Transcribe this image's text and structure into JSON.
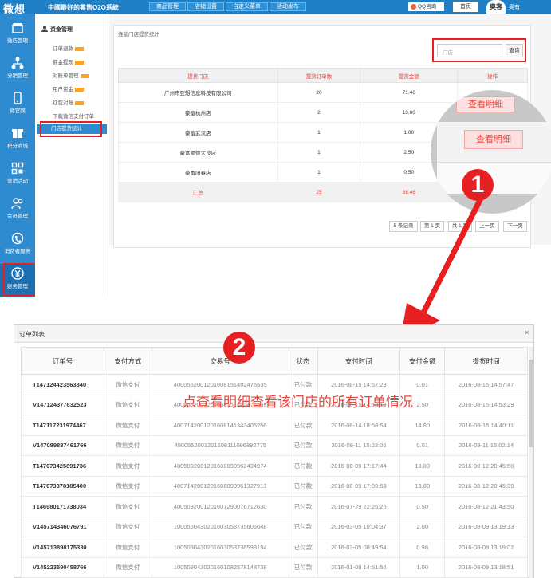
{
  "header": {
    "logo": "微想",
    "slogan": "中國最好的零售O2O系統",
    "nav": [
      "商品管理",
      "店铺设置",
      "自定义菜单",
      "活动发布"
    ],
    "qq": "QQ咨询",
    "home": "首页",
    "avatar_text": "奥客",
    "user": "奥有"
  },
  "sidebar": {
    "items": [
      {
        "label": "微店管理",
        "icon": "store-icon"
      },
      {
        "label": "分销管理",
        "icon": "distribution-icon"
      },
      {
        "label": "微官网",
        "icon": "phone-icon"
      },
      {
        "label": "积分商城",
        "icon": "points-mall-icon"
      },
      {
        "label": "营销活动",
        "icon": "marketing-icon"
      },
      {
        "label": "会员管理",
        "icon": "members-icon"
      },
      {
        "label": "消费者服务",
        "icon": "service-icon"
      },
      {
        "label": "财务管理",
        "icon": "yen-icon"
      }
    ]
  },
  "subnav": {
    "title": "资金管理",
    "items": [
      "订单退款",
      "佣金提现",
      "对账单管理",
      "用户资金",
      "红包对账",
      "下载微信支付订单"
    ],
    "active": "门店提货统计"
  },
  "main": {
    "breadcrumb": "连锁门店提货统计",
    "search_placeholder": "门店",
    "search_button": "查询",
    "columns": [
      "提货门店",
      "提货订单数",
      "提货金额",
      "操作"
    ],
    "rows": [
      [
        "广州市亚想信息科技有限公司",
        "20",
        "71.46"
      ],
      [
        "豪富杭州店",
        "2",
        "13.00"
      ],
      [
        "豪富武汉店",
        "1",
        "1.00"
      ],
      [
        "豪富顺德大良店",
        "1",
        "2.50"
      ],
      [
        "豪富阳春店",
        "1",
        "0.50"
      ]
    ],
    "summary": [
      "汇总",
      "25",
      "88.46"
    ],
    "detail_button": "查看明细",
    "pager": [
      "5 条记录",
      "第 1 页",
      "共 1 页",
      "上一页",
      "下一页"
    ]
  },
  "markers": {
    "step1": "1",
    "step2": "2"
  },
  "annotation": "点查看明细查看该门店的所有订单情况",
  "dialog": {
    "title": "订单列表",
    "close": "×",
    "columns": [
      "订单号",
      "支付方式",
      "交易号",
      "状态",
      "支付时间",
      "支付金额",
      "提货时间"
    ],
    "rows": [
      [
        "T147124423563840",
        "微信支付",
        "4000552001201608151402476535",
        "已付款",
        "2016-08-15 14:57:29",
        "0.01",
        "2016-08-15 14:57:47"
      ],
      [
        "V147124377832523",
        "微信支付",
        "4000552001201608151402476536",
        "已付款",
        "2016-08-15 14:53:19",
        "2.50",
        "2016-08-15 14:53:29"
      ],
      [
        "T147117231974467",
        "微信支付",
        "4007142001201608141343405256",
        "已付款",
        "2016-08-14 18:58:54",
        "14.80",
        "2016-08-15 14:40:11"
      ],
      [
        "V147089887461766",
        "微信支付",
        "4000552001201608111096892775",
        "已付款",
        "2016-08-11 15:02:06",
        "0.01",
        "2016-08-11 15:02:14"
      ],
      [
        "T147073425691736",
        "微信支付",
        "4005092001201608090952434974",
        "已付款",
        "2016-08-09 17:17:44",
        "13.80",
        "2016-08-12 20:45:50"
      ],
      [
        "T147073378185400",
        "微信支付",
        "4007142001201608090951327913",
        "已付款",
        "2016-08-09 17:09:53",
        "13.80",
        "2016-08-12 20:45:39"
      ],
      [
        "T146980171738034",
        "微信支付",
        "4005092001201607290076712630",
        "已付款",
        "2016-07-29 22:26:26",
        "0.50",
        "2016-08-12 21:43:50"
      ],
      [
        "V145714346076791",
        "微信支付",
        "1000550430201603053735606648",
        "已付款",
        "2016-03-05 10:04:37",
        "2.00",
        "2016-08-09 13:19:13"
      ],
      [
        "V145713898175330",
        "微信支付",
        "1005090430201603053736599194",
        "已付款",
        "2016-03-05 08:49:54",
        "0.98",
        "2016-08-09 13:19:02"
      ],
      [
        "V145223590458766",
        "微信支付",
        "1005090430201601082578148739",
        "已付款",
        "2016-01-08 14:51:56",
        "1.00",
        "2016-08-09 13:18:51"
      ]
    ]
  },
  "colors": {
    "brand": "#2f8bd0",
    "accent": "#e6453b",
    "highlight": "#e62020"
  }
}
